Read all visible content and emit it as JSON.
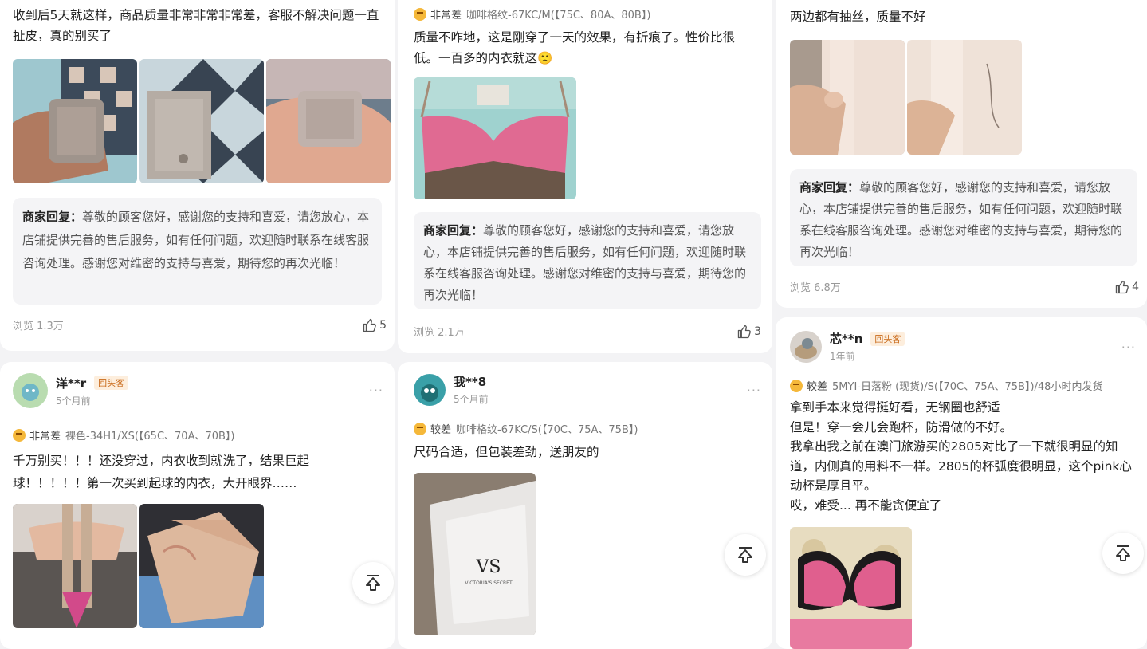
{
  "col1_top": {
    "text": "收到后5天就这样，商品质量非常非常非常差，客服不解决问题一直扯皮，真的别买了",
    "reply_label": "商家回复：",
    "reply_text": "尊敬的顾客您好，感谢您的支持和喜爱，请您放心，本店铺提供完善的售后服务，如有任何问题，欢迎随时联系在线客服咨询处理。感谢您对维密的支持与喜爱，期待您的再次光临！",
    "views": "浏览 1.3万",
    "likes": "5"
  },
  "col2_top": {
    "rating": "非常差",
    "spec": "咖啡格纹-67KC/M(【75C、80A、80B】)",
    "text": "质量不咋地，这是刚穿了一天的效果，有折痕了。性价比很低。一百多的内衣就这🙁",
    "reply_label": "商家回复：",
    "reply_text": "尊敬的顾客您好，感谢您的支持和喜爱，请您放心，本店铺提供完善的售后服务，如有任何问题，欢迎随时联系在线客服咨询处理。感谢您对维密的支持与喜爱，期待您的再次光临！",
    "views": "浏览 2.1万",
    "likes": "3"
  },
  "col3_top": {
    "text": "两边都有抽丝，质量不好",
    "reply_label": "商家回复：",
    "reply_text": "尊敬的顾客您好，感谢您的支持和喜爱，请您放心，本店铺提供完善的售后服务，如有任何问题，欢迎随时联系在线客服咨询处理。感谢您对维密的支持与喜爱，期待您的再次光临！",
    "views": "浏览 6.8万",
    "likes": "4"
  },
  "col1_bottom": {
    "username": "洋**r",
    "badge": "回头客",
    "time": "5个月前",
    "rating": "非常差",
    "spec": "裸色-34H1/XS(【65C、70A、70B】)",
    "text": "千万别买！！！还没穿过，内衣收到就洗了，结果巨起球！！！！！第一次买到起球的内衣，大开眼界……",
    "more": "···"
  },
  "col2_bottom": {
    "username": "我**8",
    "time": "5个月前",
    "rating": "较差",
    "spec": "咖啡格纹-67KC/S(【70C、75A、75B】)",
    "text": "尺码合适，但包装差劲，送朋友的",
    "more": "···",
    "box_logo": "VS",
    "box_brand": "VICTORIA'S SECRET"
  },
  "col3_bottom": {
    "username": "芯**n",
    "badge": "回头客",
    "time": "1年前",
    "rating": "较差",
    "spec": "5MYI-日落粉 (现货)/S(【70C、75A、75B】)/48小时内发货",
    "text": "拿到手本来觉得挺好看，无钢圈也舒适\n但是！穿一会儿会跑杯，防滑做的不好。\n我拿出我之前在澳门旅游买的2805对比了一下就很明显的知道，内侧真的用料不一样。2805的杯弧度很明显，这个pink心动杯是厚且平。\n哎，难受... 再不能贪便宜了",
    "more": "···"
  },
  "icons": {
    "like": "thumbs-up-icon",
    "back_to_top": "back-to-top-icon",
    "rating_face": "rating-face-icon"
  },
  "colors": {
    "badge_text": "#c96a1a",
    "badge_bg": "#fdeedd",
    "reply_bg": "#f4f4f6",
    "rating_face": "#f5b83a"
  }
}
